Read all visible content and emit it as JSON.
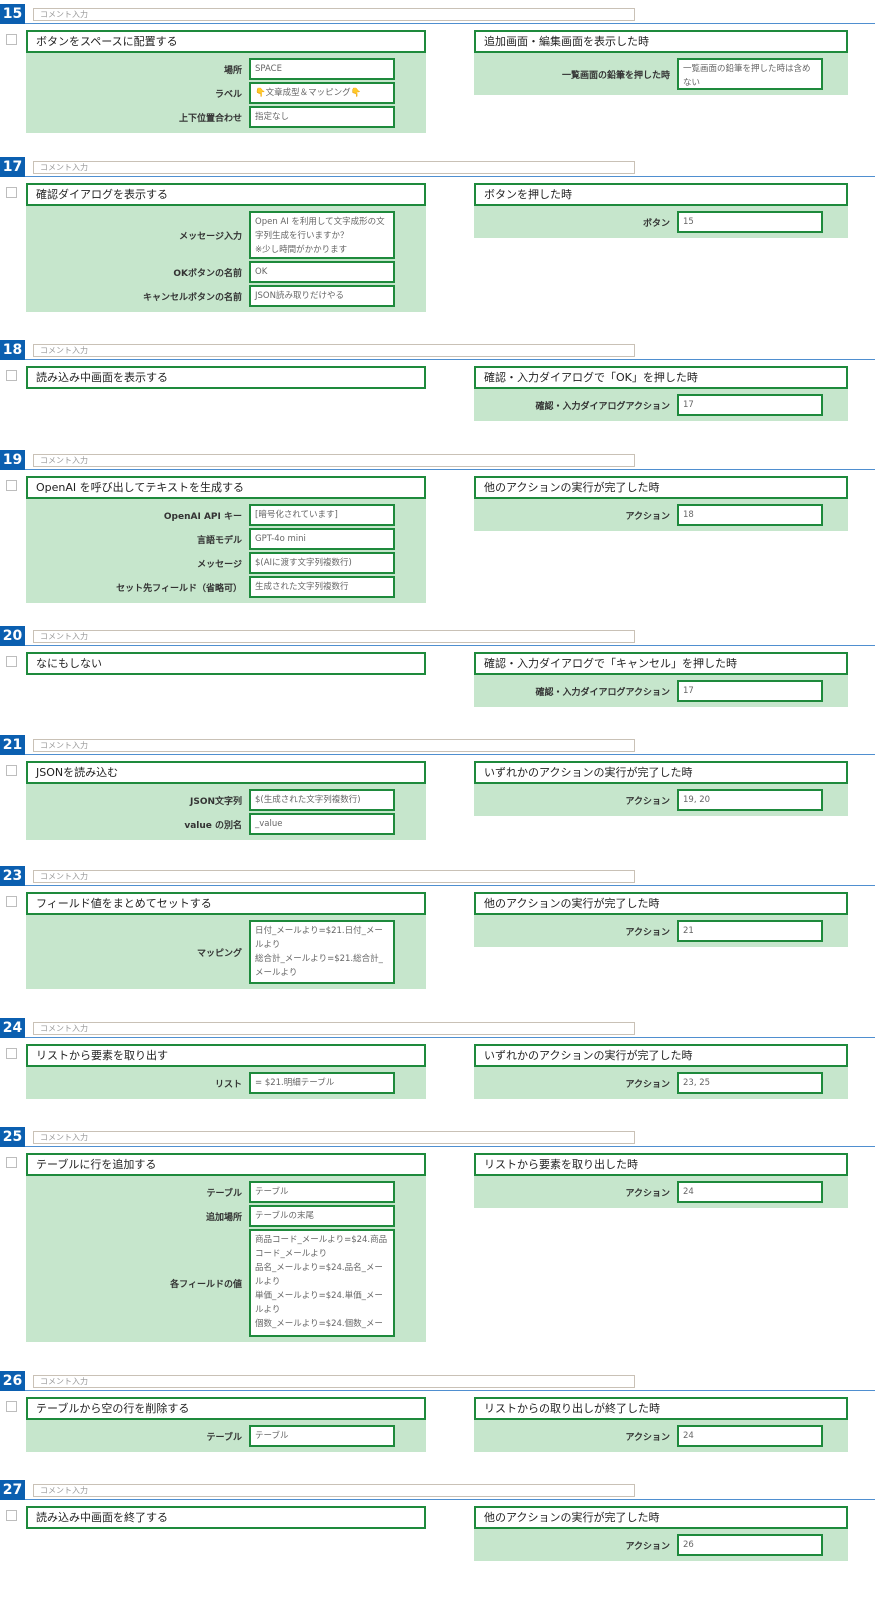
{
  "comment_placeholder": "コメント入力",
  "rows": [
    {
      "num": "15",
      "left": {
        "title": "ボタンをスペースに配置する",
        "fields": [
          {
            "label": "場所",
            "value": "SPACE"
          },
          {
            "label": "ラベル",
            "value": "👇文章成型＆マッピング👇"
          },
          {
            "label": "上下位置合わせ",
            "value": "指定なし"
          }
        ]
      },
      "right": {
        "title": "追加画面・編集画面を表示した時",
        "fields": [
          {
            "label": "一覧画面の鉛筆を押した時",
            "value": "一覧画面の鉛筆を押した時は含めない"
          }
        ]
      }
    },
    {
      "num": "17",
      "left": {
        "title": "確認ダイアログを表示する",
        "fields": [
          {
            "label": "メッセージ入力",
            "value": "Open AI を利用して文字成形の文字列生成を行いますか？\n※少し時間がかかります"
          },
          {
            "label": "OKボタンの名前",
            "value": "OK"
          },
          {
            "label": "キャンセルボタンの名前",
            "value": "JSON読み取りだけやる"
          }
        ]
      },
      "right": {
        "title": "ボタンを押した時",
        "fields": [
          {
            "label": "ボタン",
            "value": "15"
          }
        ]
      }
    },
    {
      "num": "18",
      "left": {
        "title": "読み込み中画面を表示する",
        "fields": []
      },
      "right": {
        "title": "確認・入力ダイアログで「OK」を押した時",
        "fields": [
          {
            "label": "確認・入力ダイアログアクション",
            "value": "17"
          }
        ]
      }
    },
    {
      "num": "19",
      "left": {
        "title": "OpenAI を呼び出してテキストを生成する",
        "fields": [
          {
            "label": "OpenAI API キー",
            "value": "[暗号化されています]"
          },
          {
            "label": "言語モデル",
            "value": "GPT-4o mini"
          },
          {
            "label": "メッセージ",
            "value": "$(AIに渡す文字列複数行)"
          },
          {
            "label": "セット先フィールド（省略可）",
            "value": "生成された文字列複数行"
          }
        ]
      },
      "right": {
        "title": "他のアクションの実行が完了した時",
        "fields": [
          {
            "label": "アクション",
            "value": "18"
          }
        ]
      }
    },
    {
      "num": "20",
      "left": {
        "title": "なにもしない",
        "fields": []
      },
      "right": {
        "title": "確認・入力ダイアログで「キャンセル」を押した時",
        "fields": [
          {
            "label": "確認・入力ダイアログアクション",
            "value": "17"
          }
        ]
      }
    },
    {
      "num": "21",
      "left": {
        "title": "JSONを読み込む",
        "fields": [
          {
            "label": "JSON文字列",
            "value": "$(生成された文字列複数行)"
          },
          {
            "label": "value の別名",
            "value": "_value"
          }
        ]
      },
      "right": {
        "title": "いずれかのアクションの実行が完了した時",
        "fields": [
          {
            "label": "アクション",
            "value": "19, 20"
          }
        ]
      }
    },
    {
      "num": "23",
      "left": {
        "title": "フィールド値をまとめてセットする",
        "fields": [
          {
            "label": "マッピング",
            "value": "日付_メールより=$21.日付_メールより\n総合計_メールより=$21.総合計_メールより"
          }
        ]
      },
      "right": {
        "title": "他のアクションの実行が完了した時",
        "fields": [
          {
            "label": "アクション",
            "value": "21"
          }
        ]
      }
    },
    {
      "num": "24",
      "left": {
        "title": "リストから要素を取り出す",
        "fields": [
          {
            "label": "リスト",
            "value": "= $21.明細テーブル"
          }
        ]
      },
      "right": {
        "title": "いずれかのアクションの実行が完了した時",
        "fields": [
          {
            "label": "アクション",
            "value": "23, 25"
          }
        ]
      }
    },
    {
      "num": "25",
      "left": {
        "title": "テーブルに行を追加する",
        "fields": [
          {
            "label": "テーブル",
            "value": "テーブル"
          },
          {
            "label": "追加場所",
            "value": "テーブルの末尾"
          },
          {
            "label": "各フィールドの値",
            "value": "商品コード_メールより=$24.商品コード_メールより\n品名_メールより=$24.品名_メールより\n単価_メールより=$24.単価_メールより\n個数_メールより=$24.個数_メー"
          }
        ]
      },
      "right": {
        "title": "リストから要素を取り出した時",
        "fields": [
          {
            "label": "アクション",
            "value": "24"
          }
        ]
      }
    },
    {
      "num": "26",
      "left": {
        "title": "テーブルから空の行を削除する",
        "fields": [
          {
            "label": "テーブル",
            "value": "テーブル"
          }
        ]
      },
      "right": {
        "title": "リストからの取り出しが終了した時",
        "fields": [
          {
            "label": "アクション",
            "value": "24"
          }
        ]
      }
    },
    {
      "num": "27",
      "left": {
        "title": "読み込み中画面を終了する",
        "fields": []
      },
      "right": {
        "title": "他のアクションの実行が完了した時",
        "fields": [
          {
            "label": "アクション",
            "value": "26"
          }
        ]
      }
    }
  ]
}
